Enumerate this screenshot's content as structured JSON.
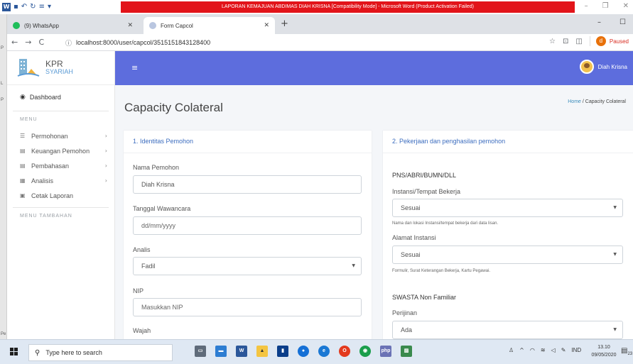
{
  "word": {
    "title": "LAPORAN KEMAJUAN ABDIMAS DIAH KRISNA [Compatibility Mode] - Microsoft Word (Product Activation Failed)",
    "strip_labels": [
      "P",
      "P",
      "L",
      "Pe"
    ]
  },
  "chrome": {
    "tabs": [
      {
        "label": "(9) WhatsApp"
      },
      {
        "label": "Form Capcol"
      }
    ],
    "url": "localhost:8000/user/capcol/3515151843128400",
    "profile_status": "Paused",
    "profile_initial": "d"
  },
  "sidebar": {
    "brand_top": "KPR",
    "brand_bottom": "SYARIAH",
    "dashboard": "Dashboard",
    "menu_heading": "MENU",
    "items": [
      {
        "label": "Permohonan"
      },
      {
        "label": "Keuangan Pemohon"
      },
      {
        "label": "Pembahasan"
      },
      {
        "label": "Analisis"
      },
      {
        "label": "Cetak Laporan"
      }
    ],
    "extra_heading": "MENU TAMBAHAN"
  },
  "topnav": {
    "user_name": "Diah Krisna"
  },
  "page": {
    "title": "Capacity Colateral",
    "breadcrumb_home": "Home",
    "breadcrumb_sep": "/",
    "breadcrumb_current": "Capacity Colateral"
  },
  "form_left": {
    "header": "1. Identitas Pemohon",
    "nama_label": "Nama Pemohon",
    "nama_value": "Diah Krisna",
    "tanggal_label": "Tanggal Wawancara",
    "tanggal_placeholder": "dd/mm/yyyy",
    "analis_label": "Analis",
    "analis_value": "Fadil",
    "nip_label": "NIP",
    "nip_placeholder": "Masukkan NIP",
    "wajah_label": "Wajah"
  },
  "form_right": {
    "header": "2. Pekerjaan dan penghasilan pemohon",
    "section_pns": "PNS/ABRI/BUMN/DLL",
    "instansi_label": "Instansi/Tempat Bekerja",
    "instansi_value": "Sesuai",
    "instansi_help": "Nama dan lokasi Instansi/tempat bekerja dari data lisan.",
    "alamat_label": "Alamat Instansi",
    "alamat_value": "Sesuai",
    "alamat_help": "Formulir, Surat Keterangan Bekerja, Kartu Pegawai.",
    "section_swasta": "SWASTA Non Familiar",
    "perijinan_label": "Perijinan",
    "perijinan_value": "Ada"
  },
  "taskbar": {
    "search_placeholder": "Type here to search",
    "language": "IND",
    "time": "13.10",
    "date": "09/05/2020",
    "notification_count": "23"
  },
  "colors": {
    "topnav": "#5d6ddd",
    "link": "#3c6dbf",
    "word_title_bar": "#e2141a"
  }
}
